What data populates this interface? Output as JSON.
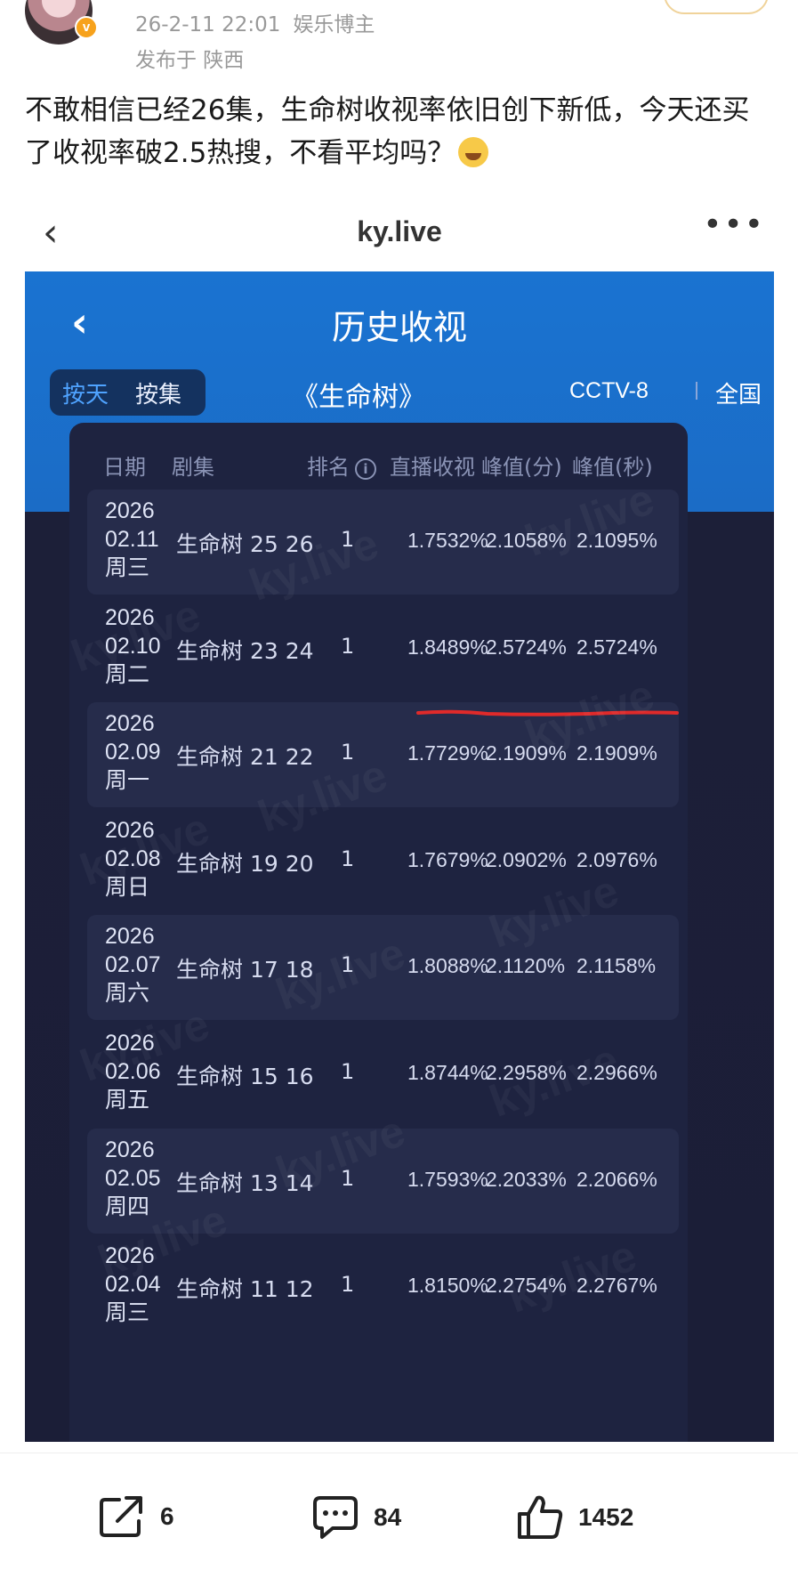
{
  "post": {
    "date": "26-2-11 22:01",
    "author_role": "娱乐博主",
    "location": "发布于 陕西",
    "text": "不敢相信已经26集，生命树收视率依旧创下新低，今天还买了收视率破2.5热搜，不看平均吗？",
    "emoji_icon": "laughing-tears-emoji"
  },
  "web_nav": {
    "back_glyph": "‹",
    "title": "ky.live",
    "more_glyph": "•••"
  },
  "app": {
    "back_glyph": "‹",
    "title": "历史收视",
    "tabs": [
      "按天",
      "按集"
    ],
    "show": "《生命树》",
    "channel": "CCTV-8",
    "region": "全国",
    "headers": {
      "date": "日期",
      "episode": "剧集",
      "rank": "排名",
      "live": "直播收视",
      "peak_min": "峰值(分)",
      "peak_sec": "峰值(秒)"
    },
    "info_glyph": "i",
    "watermark": "ky.live",
    "rows": [
      {
        "year": "2026",
        "md": "02.11",
        "weekday": "周三",
        "episode": "生命树 25 26",
        "rank": "1",
        "live": "1.7532%",
        "peak_min": "2.1058%",
        "peak_sec": "2.1095%"
      },
      {
        "year": "2026",
        "md": "02.10",
        "weekday": "周二",
        "episode": "生命树 23 24",
        "rank": "1",
        "live": "1.8489%",
        "peak_min": "2.5724%",
        "peak_sec": "2.5724%"
      },
      {
        "year": "2026",
        "md": "02.09",
        "weekday": "周一",
        "episode": "生命树 21 22",
        "rank": "1",
        "live": "1.7729%",
        "peak_min": "2.1909%",
        "peak_sec": "2.1909%"
      },
      {
        "year": "2026",
        "md": "02.08",
        "weekday": "周日",
        "episode": "生命树 19 20",
        "rank": "1",
        "live": "1.7679%",
        "peak_min": "2.0902%",
        "peak_sec": "2.0976%"
      },
      {
        "year": "2026",
        "md": "02.07",
        "weekday": "周六",
        "episode": "生命树 17 18",
        "rank": "1",
        "live": "1.8088%",
        "peak_min": "2.1120%",
        "peak_sec": "2.1158%"
      },
      {
        "year": "2026",
        "md": "02.06",
        "weekday": "周五",
        "episode": "生命树 15 16",
        "rank": "1",
        "live": "1.8744%",
        "peak_min": "2.2958%",
        "peak_sec": "2.2966%"
      },
      {
        "year": "2026",
        "md": "02.05",
        "weekday": "周四",
        "episode": "生命树 13 14",
        "rank": "1",
        "live": "1.7593%",
        "peak_min": "2.2033%",
        "peak_sec": "2.2066%"
      },
      {
        "year": "2026",
        "md": "02.04",
        "weekday": "周三",
        "episode": "生命树 11 12",
        "rank": "1",
        "live": "1.8150%",
        "peak_min": "2.2754%",
        "peak_sec": "2.2767%"
      }
    ]
  },
  "actions": {
    "share_count": "6",
    "comment_count": "84",
    "like_count": "1452"
  },
  "colors": {
    "app_blue": "#1a73d1",
    "app_dark": "#1c1f38",
    "highlight_red": "#e02a2a",
    "tab_active": "#4fa3ff"
  }
}
